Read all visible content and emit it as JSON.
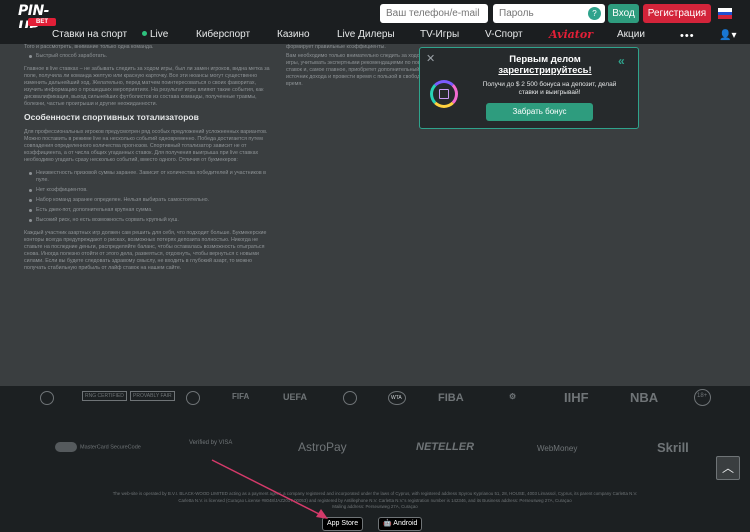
{
  "header": {
    "logo_main": "PIN-UP",
    "logo_sub": "BET",
    "phone_placeholder": "Ваш телефон/e-mail",
    "password_placeholder": "Пароль",
    "login_label": "Вход",
    "register_label": "Регистрация"
  },
  "nav": {
    "items": [
      "Ставки на спорт",
      "Live",
      "Киберспорт",
      "Казино",
      "Live Дилеры",
      "TV-Игры",
      "V-Спорт",
      "Aviator",
      "Акции"
    ],
    "more": "•••"
  },
  "article": {
    "top_line": "Того и рассмотреть, внимание только одна команда.",
    "top_bullet": "Быстрый способ заработать.",
    "p1": "Главное в live ставках – не забывать следить за ходом игры, был ли замен игроков, видна метка за поле, получила ли команда желтую или красную карточку. Все эти нюансы могут существенно изменить дальнейший ход. Желательно, перед матчем поинтересоваться о своих фаворитах, изучить информацию о прошедших мероприятиях. На результат игры влияют такие события, как дисквалификация, выход сильнейших футболистов из состава команды, полученные травмы, болезни, частые проигрыши и другие неожиданности.",
    "heading": "Особенности спортивных тотализаторов",
    "p2": "Для профессиональных игроков предусмотрен ряд особых предложений усложненных вариантов. Можно поставить в режиме live на несколько событий одновременно. Победа достигается путем совпадения определенного количества прогнозов. Спортивный тотализатор зависит не от коэффициента, а от числа общих угаданных ставок. Для получения выигрыша при live ставках необходимо угадать сразу несколько событий, вместо одного. Отличия от букмекеров:",
    "bullets": [
      "Неизвестность призовой суммы заранее. Зависит от количества победителей и участников в пуле.",
      "Нет коэффициентов.",
      "Набор команд заранее определен. Нельзя выбирать самостоятельно.",
      "Есть джек-пот, дополнительная крупная сумма.",
      "Высокий риск, но есть возможность сорвать крупный куш."
    ],
    "p3": "Каждый участник азартных игр должен сам решить для себя, что подходит больше. Букмекерские конторы всегда предупреждают о рисках, возможных потерях депозита полностью. Никогда не ставьте на последние деньги, распределяйте баланс, чтобы оставалась возможность отыграться снова. Иногда полезно отойти от этого дела, развеяться, отдохнуть, чтобы вернуться с новыми силами. Если вы будете следовать здравому смыслу, не входить в глубокий азарт, то можно получать стабильную прибыль от лайф ставок на нашем сайте.",
    "right_p1": "формирует правильные коэффициенты.",
    "right_p2": "Вам необходимо только внимательно следить за ходом игры, учитывать экспертными рекомендациями по поводу ставок и, самое главное, приобретет дополнительный источник дохода и провести время с пользой в свободное время."
  },
  "promo": {
    "title_line1": "Первым делом",
    "title_line2": "зарегистрируйтесь!",
    "text": "Получи до $ 2 500 бонуса на депозит, делай ставки и выигрывай!",
    "button": "Забрать бонус"
  },
  "logos": [
    "RNG CERTIFIED",
    "PROVABLY FAIR",
    "FIFA",
    "UEFA",
    "WTA",
    "FIBA",
    "IIHF",
    "NBA",
    "18+"
  ],
  "payments": [
    "MasterCard SecureCode",
    "Verified by VISA",
    "AstroPay",
    "NETELLER",
    "WebMoney",
    "Skrill"
  ],
  "footer": {
    "legal_line1": "The web-site is operated by B.V.I. BLACK-WOOD LIMITED acting as a payment agent, a company registered and incorporated under the laws of Cyprus, with registered address Spyrou Kyprianou 51, 28, HOUSE, 4003 Limassol, Cyprus, its parent company Carletta N.V.",
    "legal_line2": "Carletta N.V. is licensed (Curaçao License #8048/JAZ2017-00053) and registered by Antillephone N.V. Carletta N.V.'s registration number is 142346, and its Business address: Perseusweg 27A, Curaçao",
    "legal_line3": "Mailing address: Perseusweg 27A, Curaçao",
    "app_store": "App Store",
    "android": "Android"
  },
  "colors": {
    "accent_green": "#2e9c7e",
    "brand_red": "#d3243a",
    "bg_dark": "#1c2022"
  }
}
